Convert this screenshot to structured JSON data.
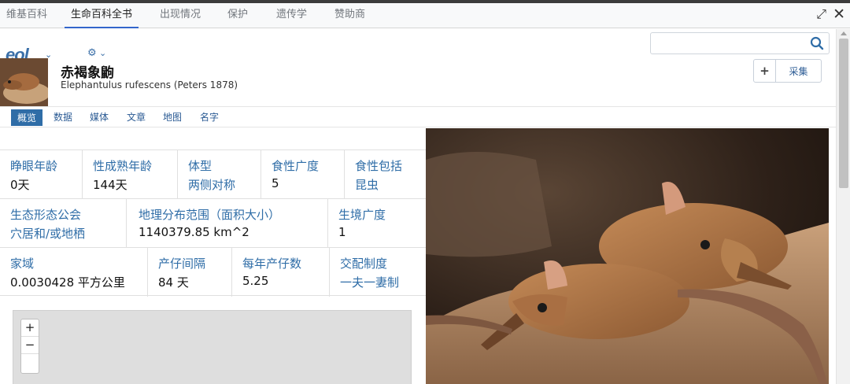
{
  "tabs": [
    {
      "label": "维基百科",
      "active": false
    },
    {
      "label": "生命百科全书",
      "active": true
    },
    {
      "label": "出现情况",
      "active": false
    },
    {
      "label": "保护",
      "active": false
    },
    {
      "label": "遗传学",
      "active": false
    },
    {
      "label": "赞助商",
      "active": false
    }
  ],
  "logo": {
    "text": "eol"
  },
  "search": {
    "placeholder": ""
  },
  "species": {
    "common_name": "赤褐象鼩",
    "scientific_name": "Elephantulus rufescens (Peters 1878)"
  },
  "collect_button": {
    "label": "采集"
  },
  "subnav": [
    {
      "label": "概览",
      "active": true
    },
    {
      "label": "数据",
      "active": false
    },
    {
      "label": "媒体",
      "active": false
    },
    {
      "label": "文章",
      "active": false
    },
    {
      "label": "地图",
      "active": false
    },
    {
      "label": "名字",
      "active": false
    }
  ],
  "traits": {
    "row1": [
      {
        "key": "睁眼年龄",
        "value": "0天"
      },
      {
        "key": "性成熟年龄",
        "value": "144天"
      },
      {
        "key": "体型",
        "value": "两侧对称"
      },
      {
        "key": "食性广度",
        "value": "5"
      },
      {
        "key": "食性包括",
        "value": "昆虫"
      }
    ],
    "row2": [
      {
        "key": "生态形态公会",
        "value": "穴居和/或地栖"
      },
      {
        "key": "地理分布范围（面积大小）",
        "value": "1140379.85 km^2"
      },
      {
        "key": "生境广度",
        "value": "1"
      }
    ],
    "row3": [
      {
        "key": "家域",
        "value": "0.0030428 平方公里"
      },
      {
        "key": "产仔间隔",
        "value": "84 天"
      },
      {
        "key": "每年产仔数",
        "value": "5.25"
      },
      {
        "key": "交配制度",
        "value": "一夫一妻制"
      }
    ]
  },
  "map_controls": {
    "zoom_in": "+",
    "zoom_out": "−"
  },
  "colors": {
    "accent": "#2f6da7",
    "logo": "#3a6fa8"
  }
}
